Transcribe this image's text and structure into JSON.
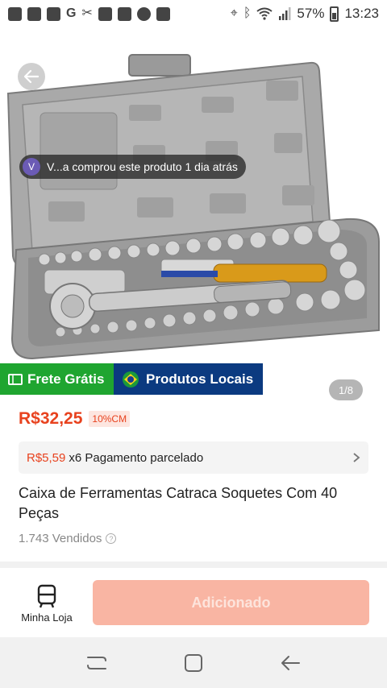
{
  "status_bar": {
    "battery": "57%",
    "time": "13:23"
  },
  "toast": {
    "avatar_letter": "V",
    "text": "V...a comprou este produto 1 dia atrás"
  },
  "gallery": {
    "counter": "1/8"
  },
  "badges": {
    "frete": "Frete Grátis",
    "locais": "Produtos Locais"
  },
  "product": {
    "price": "R$32,25",
    "discount": "10%CM",
    "installment_amount": "R$5,59",
    "installment_text": "x6 Pagamento parcelado",
    "title": "Caixa de Ferramentas Catraca Soquetes Com 40 Peças",
    "sold": "1.743 Vendidos"
  },
  "action_bar": {
    "store_label": "Minha Loja",
    "add_label": "Adicionado"
  },
  "colors": {
    "price": "#e8421e",
    "frete_badge": "#1fa530",
    "locais_badge": "#0b3a80",
    "add_button": "#f9b5a3"
  },
  "icons": [
    "back-arrow-icon",
    "store-icon",
    "recent-apps-icon",
    "home-icon",
    "back-nav-icon"
  ]
}
